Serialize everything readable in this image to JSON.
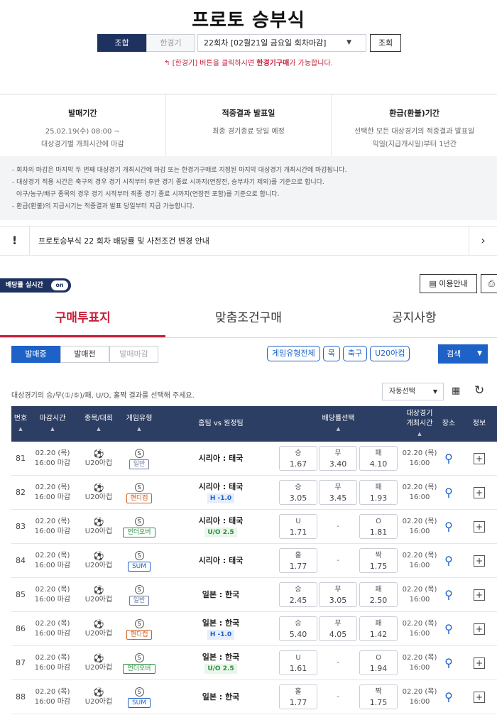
{
  "title": "프로토 승부식",
  "modes": [
    "조합",
    "한경기"
  ],
  "round_select": "22회차 [02월21일 금요일 회차마감]",
  "search_button": "조회",
  "notice_red_prefix": "[한경기] 버튼을 클릭하시면 ",
  "notice_red_bold": "한경기구매",
  "notice_red_suffix": "가 가능합니다.",
  "info": [
    {
      "title": "발매기간",
      "lines": [
        "25.02.19(수) 08:00 ~",
        "대상경기별 개최시간에 마감"
      ]
    },
    {
      "title": "적중결과 발표일",
      "lines": [
        "최종 경기종료 당일 예정"
      ]
    },
    {
      "title": "환급(환불)기간",
      "lines": [
        "선택한 모든 대상경기의 적중결과 발표일",
        "익일(지급개시일)부터 1년간"
      ]
    }
  ],
  "rules": [
    "- 회차의 마감은 마지막 두 번째 대상경기 개최시간에 마감 또는 한경기구매로 지정된 마지막 대상경기 개최시간에 마감됩니다.",
    "- 대상경기 적용 시간은 축구의 경우 경기 시작부터 후반 경기 종료 시까지(연장전, 승부차기 제외)를 기준으로 합니다.",
    "  야구/농구/배구 종목의 경우 경기 시작부터 최종 경기 종료 시까지(연장전 포함)를 기준으로 합니다.",
    "- 환급(환불)의 지급시기는 적중결과 발표 당일부터 지급 가능합니다."
  ],
  "notice_bar": "프로토승부식 22 회차 배당률 및 사전조건 변경 안내",
  "realtime_label": "배당률 실시간",
  "realtime_toggle": "on",
  "guide_button": "이용안내",
  "tabs": [
    "구매투표지",
    "맞춤조건구매",
    "공지사항"
  ],
  "status_tabs": [
    "발매중",
    "발매전",
    "발매마감"
  ],
  "filters": [
    "게임유형전체",
    "목",
    "축구",
    "U20아컵"
  ],
  "search_dropdown": "검색",
  "hint": "대상경기의 승/무(①/⑤)/패, U/O, 홀짝 결과를 선택해 주세요.",
  "auto_select": "자동선택",
  "headers": {
    "no": "번호",
    "deadline": "마감시간",
    "sport": "종목/대회",
    "type": "게임유형",
    "match": "홈팀 vs 원정팀",
    "odds": "배당률선택",
    "gametime_1": "대상경기",
    "gametime_2": "개최시간",
    "venue": "장소",
    "info": "정보"
  },
  "accent": "#1e62c8",
  "primary": "#1e3260",
  "red": "#c8203a",
  "rows": [
    {
      "no": "81",
      "date": "02.20 (목)",
      "time": "16:00 마감",
      "league": "U20아컵",
      "type": "일반",
      "tc": "b-normal",
      "teams": "시리아 : 태국",
      "tag": "",
      "tagc": "",
      "o1l": "승",
      "o1": "1.67",
      "o2l": "무",
      "o2": "3.40",
      "o3l": "패",
      "o3": "4.10",
      "gdate": "02.20 (목)",
      "gtime": "16:00"
    },
    {
      "no": "82",
      "date": "02.20 (목)",
      "time": "16:00 마감",
      "league": "U20아컵",
      "type": "핸디캡",
      "tc": "b-handi",
      "teams": "시리아 : 태국",
      "tag": "H -1.0",
      "tagc": "tag-h",
      "o1l": "승",
      "o1": "3.05",
      "o2l": "무",
      "o2": "3.45",
      "o3l": "패",
      "o3": "1.93",
      "gdate": "02.20 (목)",
      "gtime": "16:00"
    },
    {
      "no": "83",
      "date": "02.20 (목)",
      "time": "16:00 마감",
      "league": "U20아컵",
      "type": "언더오버",
      "tc": "b-uo",
      "teams": "시리아 : 태국",
      "tag": "U/O 2.5",
      "tagc": "tag-uo",
      "o1l": "U",
      "o1": "1.71",
      "o2l": "",
      "o2": "-",
      "o3l": "O",
      "o3": "1.81",
      "gdate": "02.20 (목)",
      "gtime": "16:00"
    },
    {
      "no": "84",
      "date": "02.20 (목)",
      "time": "16:00 마감",
      "league": "U20아컵",
      "type": "SUM",
      "tc": "b-sum",
      "teams": "시리아 : 태국",
      "tag": "",
      "tagc": "",
      "o1l": "홀",
      "o1": "1.77",
      "o2l": "",
      "o2": "-",
      "o3l": "짝",
      "o3": "1.75",
      "gdate": "02.20 (목)",
      "gtime": "16:00"
    },
    {
      "no": "85",
      "date": "02.20 (목)",
      "time": "16:00 마감",
      "league": "U20아컵",
      "type": "일반",
      "tc": "b-normal",
      "teams": "일본 : 한국",
      "tag": "",
      "tagc": "",
      "o1l": "승",
      "o1": "2.45",
      "o2l": "무",
      "o2": "3.05",
      "o3l": "패",
      "o3": "2.50",
      "gdate": "02.20 (목)",
      "gtime": "16:00"
    },
    {
      "no": "86",
      "date": "02.20 (목)",
      "time": "16:00 마감",
      "league": "U20아컵",
      "type": "핸디캡",
      "tc": "b-handi",
      "teams": "일본 : 한국",
      "tag": "H -1.0",
      "tagc": "tag-h",
      "o1l": "승",
      "o1": "5.40",
      "o2l": "무",
      "o2": "4.05",
      "o3l": "패",
      "o3": "1.42",
      "gdate": "02.20 (목)",
      "gtime": "16:00"
    },
    {
      "no": "87",
      "date": "02.20 (목)",
      "time": "16:00 마감",
      "league": "U20아컵",
      "type": "언더오버",
      "tc": "b-uo",
      "teams": "일본 : 한국",
      "tag": "U/O 2.5",
      "tagc": "tag-uo",
      "o1l": "U",
      "o1": "1.61",
      "o2l": "",
      "o2": "-",
      "o3l": "O",
      "o3": "1.94",
      "gdate": "02.20 (목)",
      "gtime": "16:00"
    },
    {
      "no": "88",
      "date": "02.20 (목)",
      "time": "16:00 마감",
      "league": "U20아컵",
      "type": "SUM",
      "tc": "b-sum",
      "teams": "일본 : 한국",
      "tag": "",
      "tagc": "",
      "o1l": "홀",
      "o1": "1.77",
      "o2l": "",
      "o2": "-",
      "o3l": "짝",
      "o3": "1.75",
      "gdate": "02.20 (목)",
      "gtime": "16:00"
    }
  ]
}
